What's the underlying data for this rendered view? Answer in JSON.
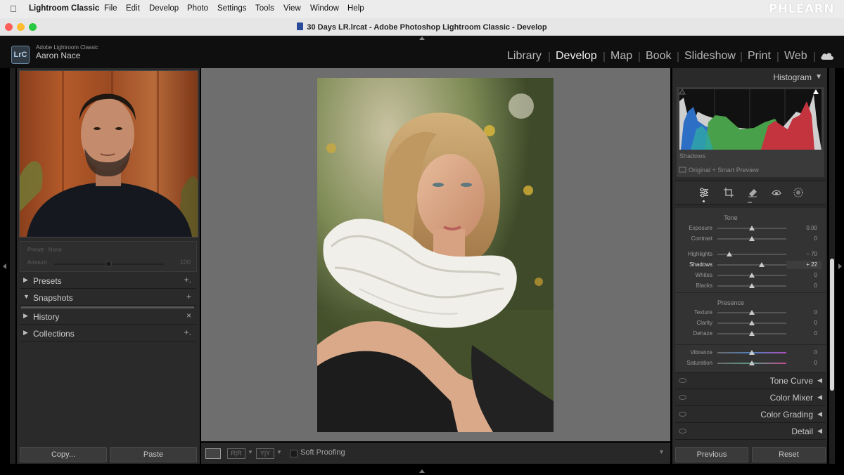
{
  "menubar": {
    "items": [
      "Lightroom Classic",
      "File",
      "Edit",
      "Develop",
      "Photo",
      "Settings",
      "Tools",
      "View",
      "Window",
      "Help"
    ],
    "brand": "PHLEARN"
  },
  "window": {
    "title": "30 Days LR.lrcat - Adobe Photoshop Lightroom Classic - Develop"
  },
  "identity": {
    "logo": "LrC",
    "app_name": "Adobe Lightroom Classic",
    "user": "Aaron Nace"
  },
  "modules": [
    "Library",
    "Develop",
    "Map",
    "Book",
    "Slideshow",
    "Print",
    "Web"
  ],
  "active_module": "Develop",
  "left": {
    "preset_label": "Preset : None",
    "amount_label": "Amount",
    "amount_value": "100",
    "panels": [
      {
        "label": "Presets",
        "expanded": false,
        "action": "+."
      },
      {
        "label": "Snapshots",
        "expanded": true,
        "action": "+"
      },
      {
        "label": "History",
        "expanded": false,
        "action": "×"
      },
      {
        "label": "Collections",
        "expanded": false,
        "action": "+."
      }
    ],
    "copy_btn": "Copy...",
    "paste_btn": "Paste"
  },
  "toolbar": {
    "soft_proofing": "Soft Proofing"
  },
  "right": {
    "histogram_title": "Histogram",
    "histogram_readout": "Shadows",
    "preview_status": "Original + Smart Preview",
    "tone_title": "Tone",
    "tone": [
      {
        "label": "Exposure",
        "value": "0.00",
        "pos": 0.5
      },
      {
        "label": "Contrast",
        "value": "0",
        "pos": 0.5
      },
      {
        "label": "Highlights",
        "value": "− 70",
        "pos": 0.17
      },
      {
        "label": "Shadows",
        "value": "+ 22",
        "pos": 0.64
      },
      {
        "label": "Whites",
        "value": "0",
        "pos": 0.5
      },
      {
        "label": "Blacks",
        "value": "0",
        "pos": 0.5
      }
    ],
    "presence_title": "Presence",
    "presence": [
      {
        "label": "Texture",
        "value": "0",
        "pos": 0.5
      },
      {
        "label": "Clarity",
        "value": "0",
        "pos": 0.5
      },
      {
        "label": "Dehaze",
        "value": "0",
        "pos": 0.5
      }
    ],
    "color": [
      {
        "label": "Vibrance",
        "value": "0",
        "pos": 0.5
      },
      {
        "label": "Saturation",
        "value": "0",
        "pos": 0.5
      }
    ],
    "panels": [
      "Tone Curve",
      "Color Mixer",
      "Color Grading",
      "Detail"
    ],
    "previous_btn": "Previous",
    "reset_btn": "Reset"
  }
}
